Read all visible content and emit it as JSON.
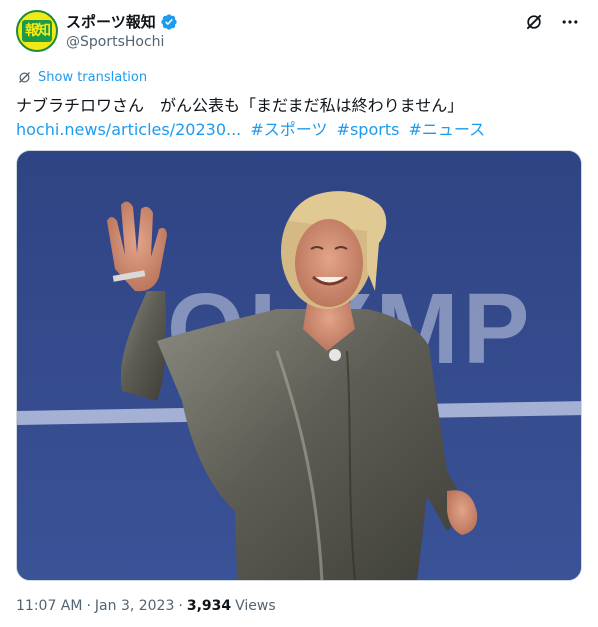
{
  "account": {
    "display_name": "スポーツ報知",
    "handle": "@SportsHochi",
    "avatar_text": "報知",
    "verified": true
  },
  "translation": {
    "label": "Show translation"
  },
  "post": {
    "text": "ナブラチロワさん　がん公表も「まだまだ私は終わりません」",
    "link": "hochi.news/articles/20230...",
    "hashtags": [
      "#スポーツ",
      "#sports",
      "#ニュース"
    ]
  },
  "media": {
    "background_text": "OLYMP"
  },
  "meta": {
    "time": "11:07 AM",
    "separator1": "·",
    "date": "Jan 3, 2023",
    "separator2": "·",
    "views_count": "3,934",
    "views_label": "Views"
  },
  "colors": {
    "link": "#1d9bf0",
    "text": "#0f1419",
    "muted": "#536471",
    "photo_bg": "#34488c"
  },
  "icons": [
    "verified-badge-icon",
    "grok-icon",
    "more-icon",
    "translate-icon"
  ]
}
